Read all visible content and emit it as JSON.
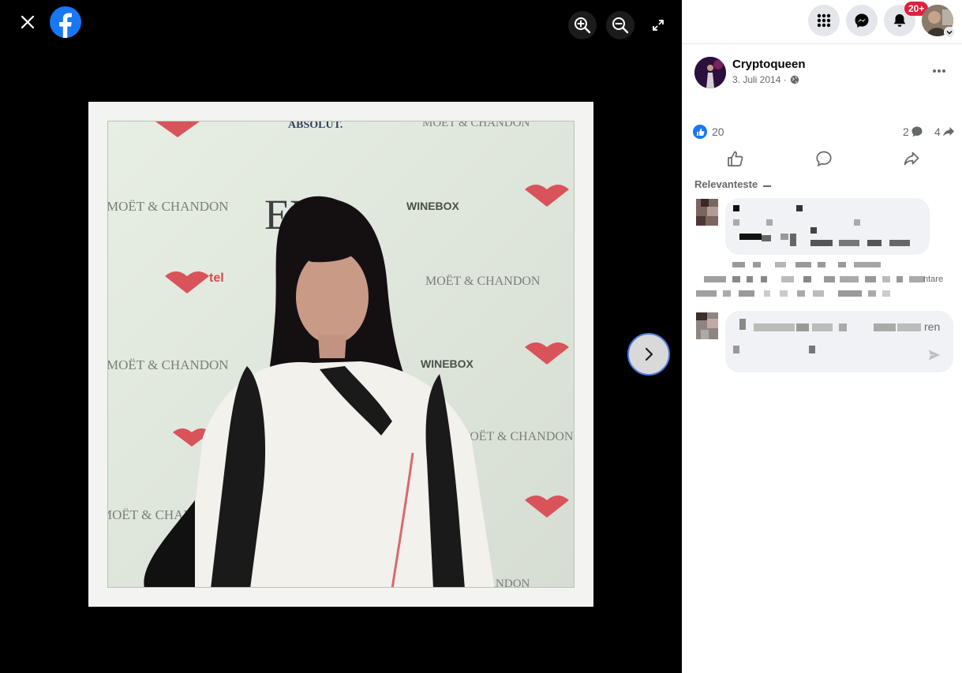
{
  "viewer": {
    "close_icon": "close-icon",
    "logo_icon": "facebook-logo",
    "zoom_in_icon": "zoom-in-icon",
    "zoom_out_icon": "zoom-out-icon",
    "fullscreen_icon": "expand-icon",
    "next_icon": "chevron-right-icon",
    "photo_texts": {
      "absolut": "ABSOLUT.",
      "moet1": "MOËT & CHANDON",
      "moet2": "MOËT & CHANDON",
      "moet3": "MOËT & CHANDON",
      "moet4": "MOËT & CHANDON",
      "moet5": "MOËT & CHANDON",
      "moet6": "MOËT & CHANDON",
      "moet7": "MOËT & CHANDON",
      "eva": "EVA",
      "winebox1": "WINEBOX",
      "winebox2": "WINEBOX",
      "tel": "tel"
    }
  },
  "topbar": {
    "menu_icon": "grid-menu-icon",
    "messenger_icon": "messenger-icon",
    "notifications_icon": "bell-icon",
    "notification_badge": "20+",
    "profile_caret_icon": "chevron-down-icon"
  },
  "post": {
    "author": "Cryptoqueen",
    "date": "3. Juli 2014 ·",
    "privacy_icon": "globe-icon",
    "more_icon": "more-icon",
    "like_count": "20",
    "comment_count": "2",
    "share_count": "4",
    "sort_label": "Relevanteste",
    "comment_cut_text": "ntare",
    "reply_cut_text": "ren"
  },
  "colors": {
    "facebook_blue": "#1877f2",
    "badge_red": "#e41e3f",
    "viewer_background": "#000000",
    "next_button_ring": "#4a7de0"
  }
}
